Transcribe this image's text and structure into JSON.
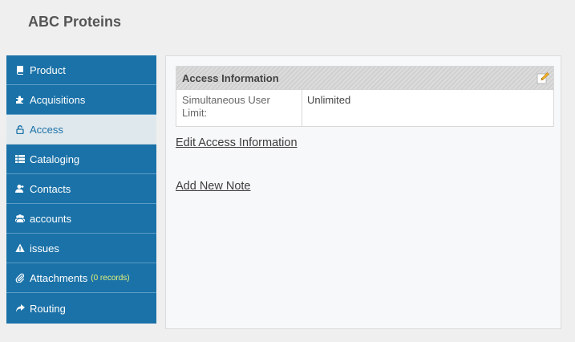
{
  "header": {
    "title": "ABC Proteins"
  },
  "sidebar": {
    "items": [
      {
        "label": "Product",
        "icon": "book-icon"
      },
      {
        "label": "Acquisitions",
        "icon": "puzzle-icon"
      },
      {
        "label": "Access",
        "icon": "unlock-icon",
        "active": true
      },
      {
        "label": "Cataloging",
        "icon": "list-icon"
      },
      {
        "label": "Contacts",
        "icon": "add-user-icon"
      },
      {
        "label": "accounts",
        "icon": "users-icon"
      },
      {
        "label": "issues",
        "icon": "warning-icon"
      },
      {
        "label": "Attachments",
        "icon": "paperclip-icon",
        "count": "(0 records)"
      },
      {
        "label": "Routing",
        "icon": "share-arrow-icon"
      }
    ]
  },
  "main": {
    "panel": {
      "title": "Access Information",
      "label": "Simultaneous User Limit:",
      "value": "Unlimited"
    },
    "links": {
      "edit": "Edit Access Information",
      "add_note": "Add New Note"
    }
  },
  "colors": {
    "nav_bg": "#1a72a8",
    "nav_active_bg": "#dfe8ed",
    "record_count": "#e4f27a"
  }
}
